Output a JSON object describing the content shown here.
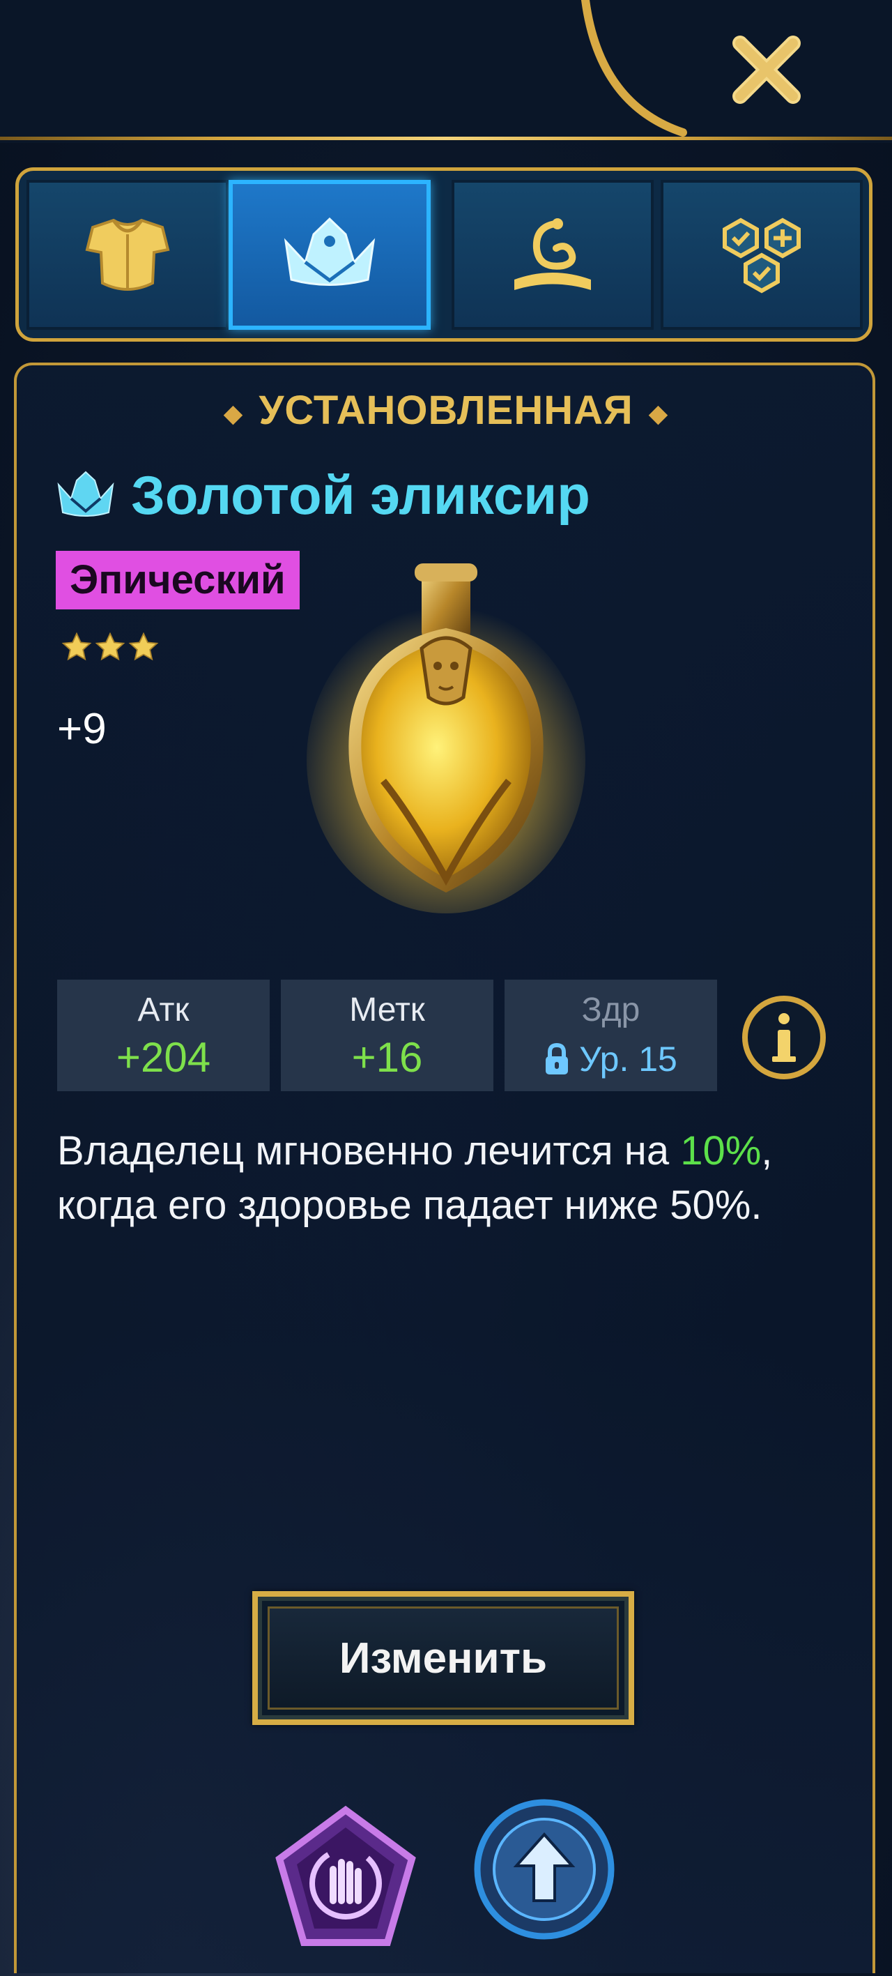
{
  "header": {
    "close_icon": "close-icon"
  },
  "tabs": [
    {
      "icon": "armor-icon",
      "active": false
    },
    {
      "icon": "crown-icon",
      "active": true
    },
    {
      "icon": "dragon-book-icon",
      "active": false
    },
    {
      "icon": "set-bonus-icon",
      "active": false
    }
  ],
  "item": {
    "status": "УСТАНОВЛЕННАЯ",
    "name": "Золотой эликсир",
    "rarity": "Эпический",
    "rarity_color": "#e04fe2",
    "stars": 3,
    "upgrade": "+9",
    "image_icon": "golden-elixir-artifact"
  },
  "stats": [
    {
      "label": "Атк",
      "value": "+204",
      "locked": false
    },
    {
      "label": "Метк",
      "value": "+16",
      "locked": false
    },
    {
      "label": "Здр",
      "value": "Ур. 15",
      "locked": true
    }
  ],
  "description": {
    "part1": "Владелец мгновенно лечится на",
    "highlight": "10%",
    "part2": ", когда его здоровье падает ниже 50%."
  },
  "actions": {
    "change_label": "Изменить",
    "left_icon": "spell-hand-icon",
    "right_icon": "upgrade-arrow-icon"
  },
  "colors": {
    "gold": "#d0a43c",
    "title_cyan": "#55d8f2",
    "stat_green": "#7ee04b",
    "locked_blue": "#6ec8ff",
    "highlight_green": "#5ce04a"
  }
}
